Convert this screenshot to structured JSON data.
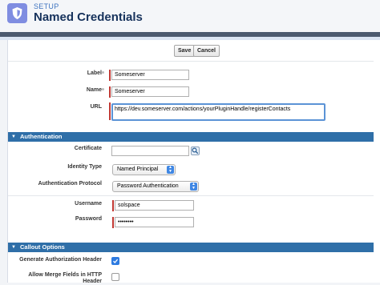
{
  "header": {
    "section": "SETUP",
    "title": "Named Credentials"
  },
  "toolbar": {
    "save_label": "Save",
    "cancel_label": "Cancel"
  },
  "fields": {
    "label": {
      "label": "Label",
      "value": "Someserver"
    },
    "name": {
      "label": "Name",
      "value": "Someserver"
    },
    "url": {
      "label": "URL",
      "value": "https://dev.someserver.com/actions/yourPluginHandle/registerContacts"
    }
  },
  "authentication": {
    "section_title": "Authentication",
    "certificate": {
      "label": "Certificate",
      "value": ""
    },
    "identity_type": {
      "label": "Identity Type",
      "value": "Named Principal"
    },
    "auth_protocol": {
      "label": "Authentication Protocol",
      "value": "Password Authentication"
    },
    "username": {
      "label": "Username",
      "value": "solspace"
    },
    "password": {
      "label": "Password",
      "value": "••••••••"
    }
  },
  "callout": {
    "section_title": "Callout Options",
    "generate_auth_header": {
      "label": "Generate Authorization Header",
      "checked": true
    },
    "allow_merge_fields": {
      "label": "Allow Merge Fields in HTTP Header",
      "checked": false
    }
  },
  "icons": {
    "app_icon": "shield-icon",
    "lookup_icon": "magnifier-icon",
    "collapse_icon": "triangle-down-icon",
    "select_icon": "up-down-arrows-icon",
    "check_icon": "checkmark-icon"
  },
  "colors": {
    "required": "#c23934",
    "section_bar": "#2f6fa8",
    "select_arrow": "#3f87e4",
    "checkbox_checked": "#2e7be0"
  }
}
